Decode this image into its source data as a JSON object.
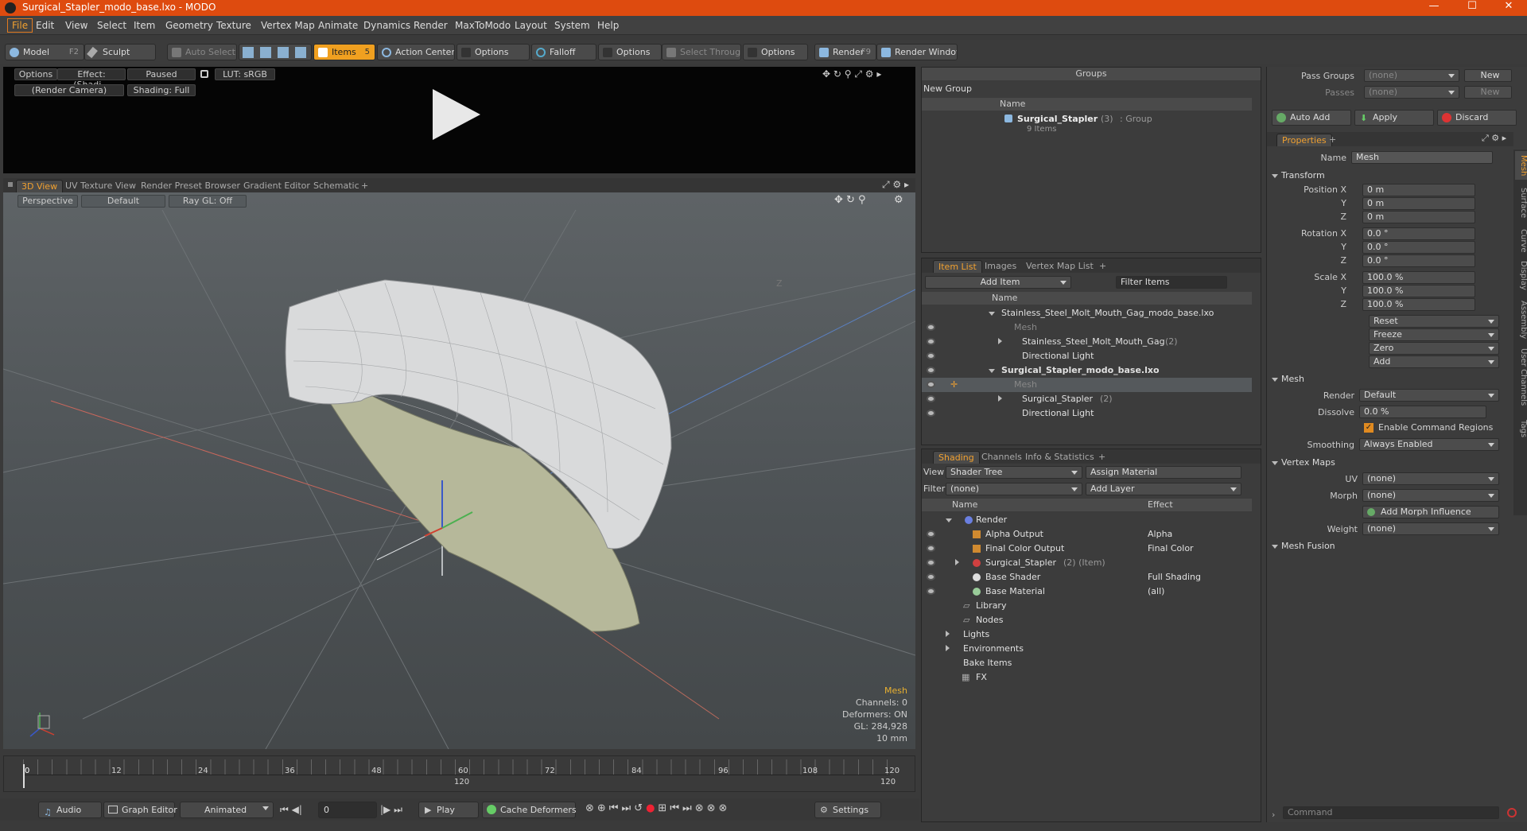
{
  "window": {
    "title": "Surgical_Stapler_modo_base.lxo - MODO",
    "minimize": "—",
    "maximize": "☐",
    "close": "✕"
  },
  "menu": [
    "File",
    "Edit",
    "View",
    "Select",
    "Item",
    "Geometry",
    "Texture",
    "Vertex Map",
    "Animate",
    "Dynamics",
    "Render",
    "MaxToModo",
    "Layout",
    "System",
    "Help"
  ],
  "toolbar": {
    "model": "Model",
    "model_key": "F2",
    "sculpt": "Sculpt",
    "auto_select": "Auto Select",
    "items": "Items",
    "items_key": "5",
    "action_center": "Action Center",
    "options1": "Options",
    "falloff": "Falloff",
    "options2": "Options",
    "select_through": "Select Through",
    "options3": "Options",
    "render": "Render",
    "render_key": "F9",
    "render_window": "Render Window"
  },
  "preview": {
    "options": "Options",
    "effect": "Effect: (Shadi...",
    "paused": "Paused",
    "lut": "LUT: sRGB",
    "camera": "(Render Camera)",
    "shading": "Shading: Full"
  },
  "view_tabs": [
    "3D View",
    "UV Texture View",
    "Render Preset Browser",
    "Gradient Editor",
    "Schematic",
    "+"
  ],
  "viewport": {
    "perspective": "Perspective",
    "default": "Default",
    "raygl": "Ray GL: Off",
    "axis_label": "Z"
  },
  "stats": {
    "mesh": "Mesh",
    "channels": "Channels: 0",
    "deformers": "Deformers: ON",
    "gl": "GL: 284,928",
    "size": "10 mm"
  },
  "timeline": {
    "ticks": [
      "0",
      "12",
      "24",
      "36",
      "48",
      "60",
      "72",
      "84",
      "96",
      "108",
      "120"
    ],
    "mid": "120",
    "end": "120"
  },
  "bottom": {
    "audio": "Audio",
    "graph_editor": "Graph Editor",
    "animated": "Animated",
    "frame": "0",
    "play": "Play",
    "cache": "Cache Deformers",
    "settings": "Settings"
  },
  "groups": {
    "title": "Groups",
    "new_group": "New Group",
    "col_name": "Name",
    "item_name": "Surgical_Stapler",
    "item_count": "(3)",
    "item_type": ": Group",
    "item_sub": "9 Items"
  },
  "item_list": {
    "tabs": [
      "Item List",
      "Images",
      "Vertex Map List",
      "+"
    ],
    "add_item": "Add Item",
    "filter": "Filter Items",
    "col_name": "Name",
    "rows": [
      {
        "label": "Stainless_Steel_Molt_Mouth_Gag_modo_base.lxo",
        "extra": ""
      },
      {
        "label": "Mesh",
        "extra": ""
      },
      {
        "label": "Stainless_Steel_Molt_Mouth_Gag",
        "extra": "(2)"
      },
      {
        "label": "Directional Light",
        "extra": ""
      },
      {
        "label": "Surgical_Stapler_modo_base.lxo",
        "extra": ""
      },
      {
        "label": "Mesh",
        "extra": ""
      },
      {
        "label": "Surgical_Stapler",
        "extra": "(2)"
      },
      {
        "label": "Directional Light",
        "extra": ""
      }
    ]
  },
  "shading": {
    "tabs": [
      "Shading",
      "Channels",
      "Info & Statistics",
      "+"
    ],
    "view_label": "View",
    "view_value": "Shader Tree",
    "assign": "Assign Material",
    "filter_label": "Filter",
    "filter_value": "(none)",
    "add_layer": "Add Layer",
    "col_name": "Name",
    "col_effect": "Effect",
    "rows": [
      {
        "label": "Render",
        "extra": "",
        "effect": ""
      },
      {
        "label": "Alpha Output",
        "extra": "",
        "effect": "Alpha"
      },
      {
        "label": "Final Color Output",
        "extra": "",
        "effect": "Final Color"
      },
      {
        "label": "Surgical_Stapler",
        "extra": "(2) (Item)",
        "effect": ""
      },
      {
        "label": "Base Shader",
        "extra": "",
        "effect": "Full Shading"
      },
      {
        "label": "Base Material",
        "extra": "",
        "effect": "(all)"
      },
      {
        "label": "Library",
        "extra": "",
        "effect": ""
      },
      {
        "label": "Nodes",
        "extra": "",
        "effect": ""
      },
      {
        "label": "Lights",
        "extra": "",
        "effect": ""
      },
      {
        "label": "Environments",
        "extra": "",
        "effect": ""
      },
      {
        "label": "Bake Items",
        "extra": "",
        "effect": ""
      },
      {
        "label": "FX",
        "extra": "",
        "effect": ""
      }
    ]
  },
  "props": {
    "pass_groups": "Pass Groups",
    "pass_groups_val": "(none)",
    "new1": "New",
    "passes": "Passes",
    "passes_val": "(none)",
    "new2": "New",
    "auto_add": "Auto Add",
    "apply": "Apply",
    "discard": "Discard",
    "tab": "Properties",
    "plus": "+",
    "name_label": "Name",
    "name_value": "Mesh",
    "transform": "Transform",
    "pos_label": "Position X",
    "y": "Y",
    "z": "Z",
    "pos": [
      "0 m",
      "0 m",
      "0 m"
    ],
    "rot_label": "Rotation X",
    "rot": [
      "0.0 °",
      "0.0 °",
      "0.0 °"
    ],
    "scale_label": "Scale X",
    "scale": [
      "100.0 %",
      "100.0 %",
      "100.0 %"
    ],
    "reset": "Reset",
    "freeze": "Freeze",
    "zero": "Zero",
    "add": "Add",
    "mesh": "Mesh",
    "render_label": "Render",
    "render_val": "Default",
    "dissolve_label": "Dissolve",
    "dissolve_val": "0.0 %",
    "enable_cmd": "Enable Command Regions",
    "smoothing_label": "Smoothing",
    "smoothing_val": "Always Enabled",
    "vertex_maps": "Vertex Maps",
    "uv_label": "UV",
    "uv_val": "(none)",
    "morph_label": "Morph",
    "morph_val": "(none)",
    "add_morph": "Add Morph Influence",
    "weight_label": "Weight",
    "weight_val": "(none)",
    "mesh_fusion": "Mesh Fusion",
    "vtabs": [
      "Mesh",
      "Surface",
      "Curve",
      "Display",
      "Assembly",
      "User Channels",
      "Tags"
    ],
    "command": "Command"
  }
}
